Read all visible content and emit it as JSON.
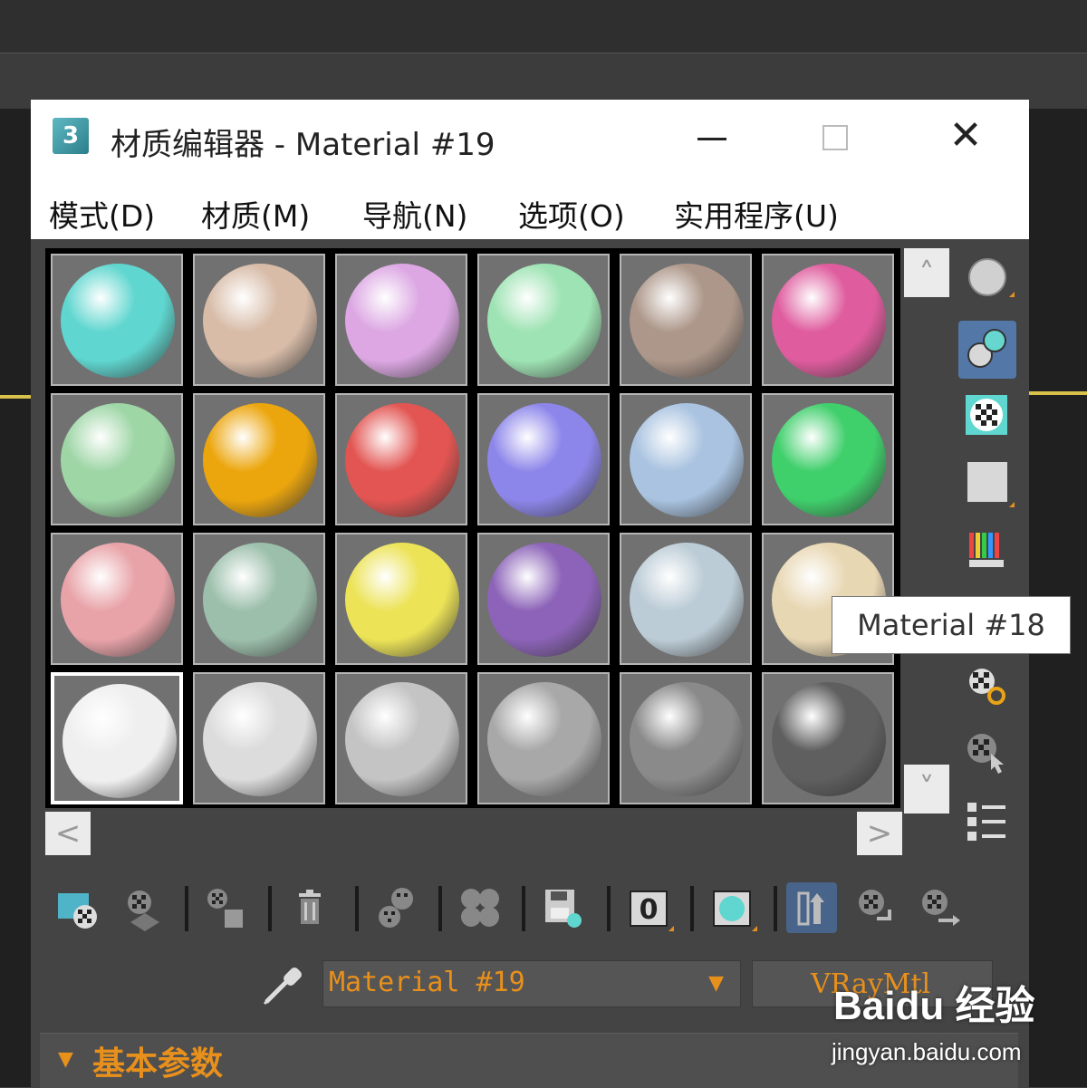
{
  "window": {
    "title": "材质编辑器 - Material #19",
    "app_icon_glyph": "3",
    "controls": {
      "minimize": "—",
      "maximize": "☐",
      "close": "✕"
    }
  },
  "menu": [
    "模式(D)",
    "材质(M)",
    "导航(N)",
    "选项(O)",
    "实用程序(U)"
  ],
  "sample_slots": [
    {
      "color": "#5fd6cf"
    },
    {
      "color": "#d8bca8"
    },
    {
      "color": "#dca7e3"
    },
    {
      "color": "#9ee3b3"
    },
    {
      "color": "#ad978a"
    },
    {
      "color": "#df5c9e"
    },
    {
      "color": "#9ed6a6"
    },
    {
      "color": "#eca60d"
    },
    {
      "color": "#e25552"
    },
    {
      "color": "#8d86ea"
    },
    {
      "color": "#a9c3e0"
    },
    {
      "color": "#3fcf6b"
    },
    {
      "color": "#e8a3a8"
    },
    {
      "color": "#9cbfab"
    },
    {
      "color": "#ece357"
    },
    {
      "color": "#8c63b8"
    },
    {
      "color": "#bcccd6"
    },
    {
      "color": "#e8d7b3"
    },
    {
      "color": "#efefef"
    },
    {
      "color": "#dcdcdc"
    },
    {
      "color": "#c4c4c4"
    },
    {
      "color": "#a8a8a8"
    },
    {
      "color": "#8a8a8a"
    },
    {
      "color": "#5f5f5f"
    }
  ],
  "active_slot_index": 18,
  "scroll": {
    "up": "˄",
    "down": "˅",
    "left": "<",
    "right": ">"
  },
  "side_tools": [
    "sample-type-sphere-icon",
    "backlight-icon",
    "background-checker-icon",
    "sample-uv-tiling-icon",
    "video-color-check-icon",
    "make-preview-icon",
    "options-icon",
    "select-by-material-icon",
    "material-map-navigator-icon"
  ],
  "tooltip": "Material #18",
  "toolbar": {
    "zero_label": "0",
    "icons": [
      "get-material-icon",
      "put-material-to-scene-icon",
      "assign-material-to-selection-icon",
      "reset-map-icon",
      "make-material-copy-icon",
      "make-unique-icon",
      "put-to-library-icon",
      "material-id-channel-icon",
      "show-shaded-material-icon",
      "show-end-result-icon",
      "go-to-parent-icon",
      "go-forward-to-sibling-icon"
    ]
  },
  "material_name": "Material #19",
  "material_type": "VRayMtl",
  "dropdown_arrow": "▼",
  "rollout": {
    "arrow": "▼",
    "title": "基本参数"
  },
  "watermark": {
    "logo": "Baidu 经验",
    "url": "jingyan.baidu.com"
  }
}
